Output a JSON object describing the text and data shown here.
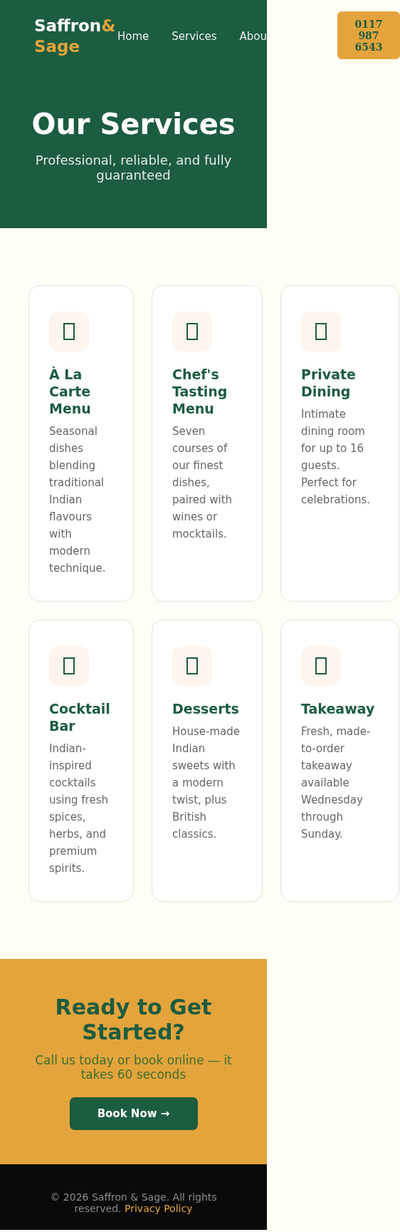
{
  "header": {
    "logo": {
      "primary": "Saffron",
      "accent": "& Sage"
    },
    "nav": [
      {
        "label": "Home"
      },
      {
        "label": "Services"
      },
      {
        "label": "Abou"
      }
    ],
    "phone_button": "0117 987 6543"
  },
  "hero": {
    "title": "Our Services",
    "subtitle": "Professional, reliable, and fully guaranteed"
  },
  "services": [
    {
      "title": "À La Carte Menu",
      "description": "Seasonal dishes blending traditional Indian flavours with modern technique."
    },
    {
      "title": "Chef's Tasting Menu",
      "description": "Seven courses of our finest dishes, paired with wines or mocktails."
    },
    {
      "title": "Private Dining",
      "description": "Intimate dining room for up to 16 guests. Perfect for celebrations."
    },
    {
      "title": "Cocktail Bar",
      "description": "Indian-inspired cocktails using fresh spices, herbs, and premium spirits."
    },
    {
      "title": "Desserts",
      "description": "House-made Indian sweets with a modern twist, plus British classics."
    },
    {
      "title": "Takeaway",
      "description": "Fresh, made-to-order takeaway available Wednesday through Sunday."
    }
  ],
  "cta": {
    "title": "Ready to Get Started?",
    "subtitle": "Call us today or book online — it takes 60 seconds",
    "button": "Book Now →"
  },
  "footer": {
    "text": "© 2026 Saffron & Sage. All rights reserved.",
    "link": "Privacy Policy"
  }
}
